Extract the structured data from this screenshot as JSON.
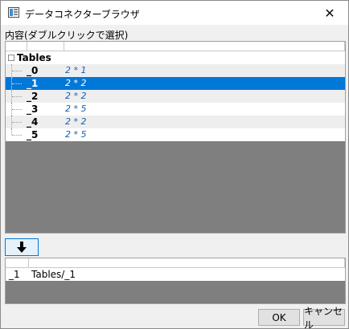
{
  "window": {
    "title": "データコネクターブラウザ",
    "close_glyph": "✕"
  },
  "contents_label": "内容(ダブルクリックで選択)",
  "tree": {
    "root_label": "Tables",
    "nodes": [
      {
        "name": "_0",
        "dims": "2 * 1",
        "selected": false
      },
      {
        "name": "_1",
        "dims": "2 * 2",
        "selected": true
      },
      {
        "name": "_2",
        "dims": "2 * 2",
        "selected": false
      },
      {
        "name": "_3",
        "dims": "2 * 5",
        "selected": false
      },
      {
        "name": "_4",
        "dims": "2 * 2",
        "selected": false
      },
      {
        "name": "_5",
        "dims": "2 * 5",
        "selected": false
      }
    ]
  },
  "selection": {
    "name": "_1",
    "path": "Tables/_1"
  },
  "buttons": {
    "ok": "OK",
    "cancel": "キャンセル"
  },
  "colors": {
    "selection": "#0078d7",
    "dims_text": "#1a5fb4",
    "empty_area": "#7f7f7f"
  },
  "icons": {
    "app": "app-window-icon",
    "close": "close-icon",
    "add_selection": "arrow-down-icon",
    "expander": "expander-icon"
  }
}
